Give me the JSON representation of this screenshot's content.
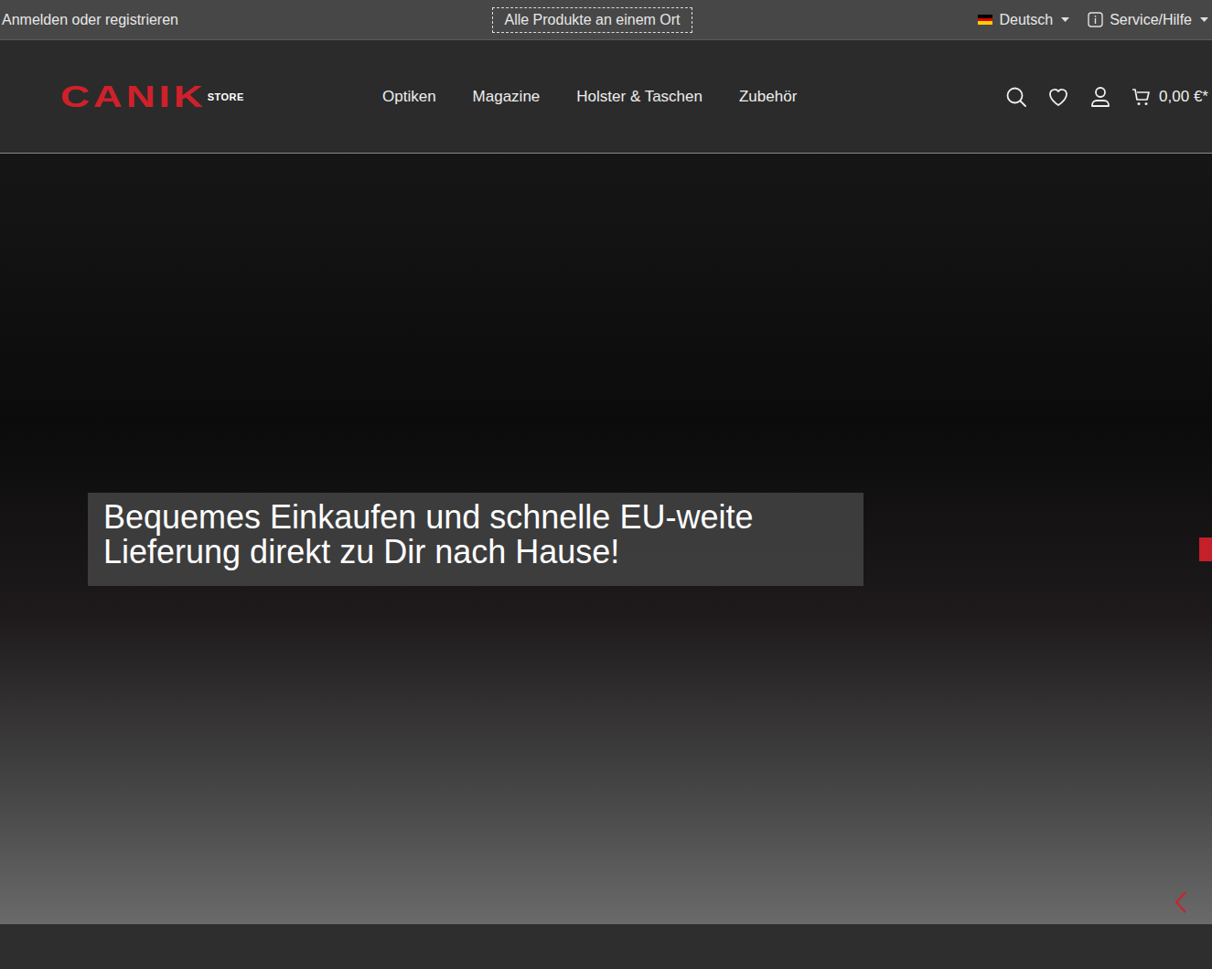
{
  "topbar": {
    "login": "Anmelden oder registrieren",
    "promo": "Alle Produkte an einem Ort",
    "language": "Deutsch",
    "service": "Service/Hilfe"
  },
  "logo": {
    "brand": "CANIK",
    "sub": "STORE"
  },
  "nav": [
    {
      "label": "Optiken"
    },
    {
      "label": "Magazine"
    },
    {
      "label": "Holster & Taschen"
    },
    {
      "label": "Zubehör"
    }
  ],
  "cart": {
    "total": "0,00 €*"
  },
  "hero": {
    "headline": "Bequemes Einkaufen und schnelle EU-weite Lieferung direkt zu Dir nach Hause!"
  }
}
